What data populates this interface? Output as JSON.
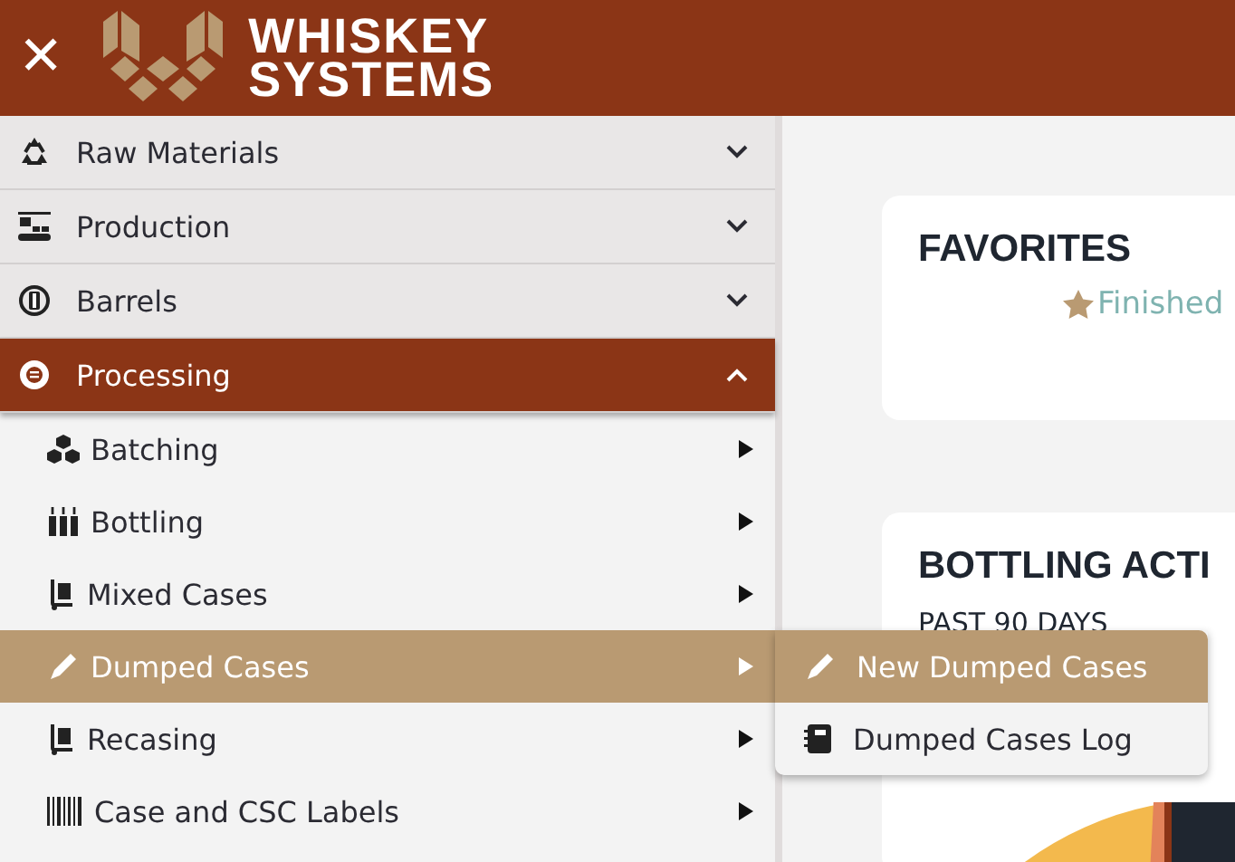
{
  "header": {
    "close_icon_text": "✕",
    "brand": [
      "WHISKEY",
      "SYSTEMS"
    ]
  },
  "sidebar": {
    "sections": [
      {
        "label": "Raw Materials",
        "expanded": false,
        "selected": false
      },
      {
        "label": "Production",
        "expanded": false,
        "selected": false
      },
      {
        "label": "Barrels",
        "expanded": false,
        "selected": false
      },
      {
        "label": "Processing",
        "expanded": true,
        "selected": true,
        "children": [
          {
            "label": "Batching",
            "selected": false
          },
          {
            "label": "Bottling",
            "selected": false
          },
          {
            "label": "Mixed Cases",
            "selected": false
          },
          {
            "label": "Dumped Cases",
            "selected": true,
            "submenu": [
              {
                "label": "New Dumped Cases",
                "selected": true
              },
              {
                "label": "Dumped Cases Log",
                "selected": false
              }
            ]
          },
          {
            "label": "Recasing",
            "selected": false
          },
          {
            "label": "Case and CSC Labels",
            "selected": false
          }
        ]
      }
    ]
  },
  "main": {
    "favorites": {
      "title": "FAVORITES",
      "items": [
        "Finished"
      ]
    },
    "bottling": {
      "title": "BOTTLING ACTI",
      "subtitle": "PAST 90 DAYS"
    }
  }
}
